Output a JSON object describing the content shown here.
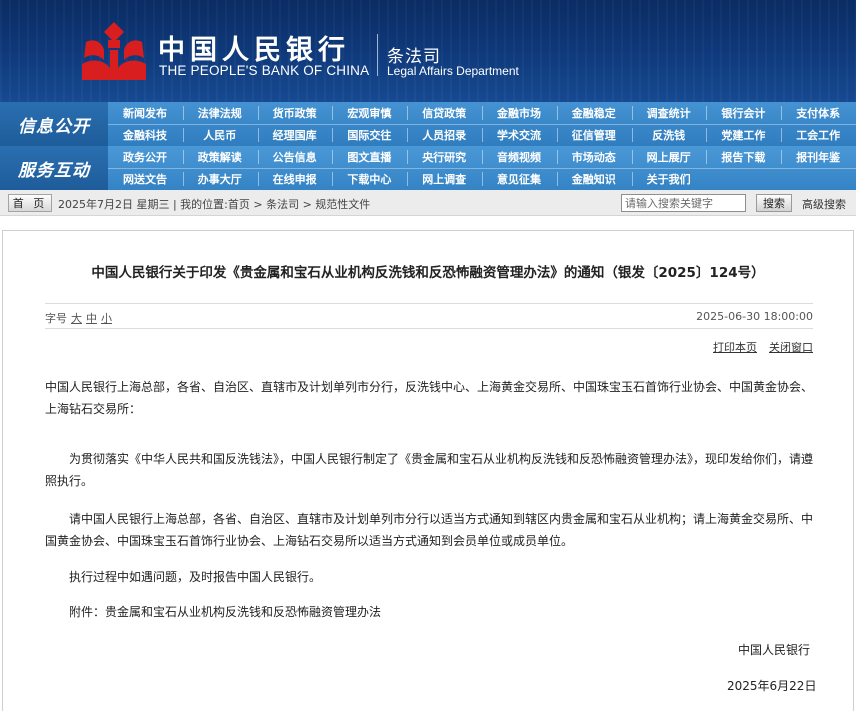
{
  "header": {
    "bank_cn": "中国人民银行",
    "bank_en": "THE PEOPLE'S BANK OF CHINA",
    "dept_cn": "条法司",
    "dept_en": "Legal Affairs Department",
    "brand_color": "#d81e1e"
  },
  "nav": {
    "row1_head": "信息公开",
    "row2_head": "服务互动",
    "row1_items": [
      "新闻发布",
      "法律法规",
      "货币政策",
      "宏观审慎",
      "信贷政策",
      "金融市场",
      "金融稳定",
      "调查统计",
      "银行会计",
      "支付体系",
      "金融科技",
      "人民币",
      "经理国库",
      "国际交往",
      "人员招录",
      "学术交流",
      "征信管理",
      "反洗钱",
      "党建工作",
      "工会工作"
    ],
    "row2_items": [
      "政务公开",
      "政策解读",
      "公告信息",
      "图文直播",
      "央行研究",
      "音频视频",
      "市场动态",
      "网上展厅",
      "报告下载",
      "报刊年鉴",
      "网送文告",
      "办事大厅",
      "在线申报",
      "下载中心",
      "网上调查",
      "意见征集",
      "金融知识",
      "关于我们"
    ]
  },
  "crumb": {
    "home": "首 页",
    "text": "2025年7月2日 星期三 | 我的位置:首页 > 条法司 > 规范性文件",
    "search_placeholder": "请输入搜索关键字",
    "search_btn": "搜索",
    "advanced": "高级搜索"
  },
  "article": {
    "title": "中国人民银行关于印发《贵金属和宝石从业机构反洗钱和反恐怖融资管理办法》的通知（银发〔2025〕124号）",
    "font_size_label": "字号",
    "font_sizes": [
      "大",
      "中",
      "小"
    ],
    "date": "2025-06-30 18:00:00",
    "print": "打印本页",
    "close": "关闭窗口",
    "addressee": "中国人民银行上海总部，各省、自治区、直辖市及计划单列市分行，反洗钱中心、上海黄金交易所、中国珠宝玉石首饰行业协会、中国黄金协会、上海钻石交易所：",
    "p1": "为贯彻落实《中华人民共和国反洗钱法》，中国人民银行制定了《贵金属和宝石从业机构反洗钱和反恐怖融资管理办法》，现印发给你们，请遵照执行。",
    "p2": "请中国人民银行上海总部，各省、自治区、直辖市及计划单列市分行以适当方式通知到辖区内贵金属和宝石从业机构；请上海黄金交易所、中国黄金协会、中国珠宝玉石首饰行业协会、上海钻石交易所以适当方式通知到会员单位或成员单位。",
    "p3": "执行过程中如遇问题，及时报告中国人民银行。",
    "p4": "附件：贵金属和宝石从业机构反洗钱和反恐怖融资管理办法",
    "signer": "中国人民银行",
    "sign_date": "2025年6月22日"
  }
}
